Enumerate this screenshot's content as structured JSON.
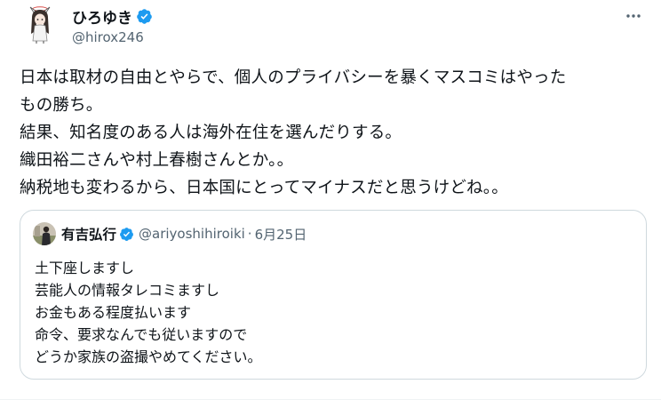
{
  "author": {
    "display_name": "ひろゆき",
    "handle": "@hirox246",
    "verified_icon": "verified-badge-icon",
    "accent_color": "#1d9bf0"
  },
  "more_menu": {
    "icon": "more-dots-icon"
  },
  "tweet": {
    "lines": [
      "日本は取材の自由とやらで、個人のプライバシーを暴くマスコミはやった",
      "もの勝ち。",
      "結果、知名度のある人は海外在住を選んだりする。",
      "織田裕二さんや村上春樹さんとか。。",
      "納税地も変わるから、日本国にとってマイナスだと思うけどね。。"
    ]
  },
  "quoted_tweet": {
    "display_name": "有吉弘行",
    "handle": "@ariyoshihiroiki",
    "separator": "·",
    "date": "6月25日",
    "lines": [
      "土下座しますし",
      "芸能人の情報タレコミますし",
      "お金もある程度払います",
      "命令、要求なんでも従いますので",
      "どうか家族の盗撮やめてください。"
    ]
  }
}
